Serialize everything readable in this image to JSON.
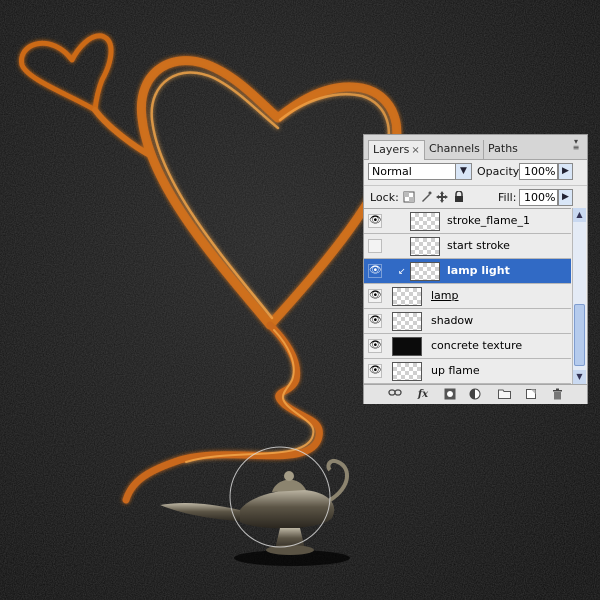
{
  "panel": {
    "tabs": [
      {
        "label": "Layers",
        "active": true
      },
      {
        "label": "Channels",
        "active": false
      },
      {
        "label": "Paths",
        "active": false
      }
    ],
    "close_glyph": "×",
    "menu_icon": "panel-menu-icon"
  },
  "blend_mode": {
    "value": "Normal"
  },
  "opacity": {
    "label": "Opacity:",
    "value": "100%"
  },
  "lock": {
    "label": "Lock:",
    "icons": [
      "lock-transparent-icon",
      "lock-image-icon",
      "lock-position-icon",
      "lock-all-icon"
    ]
  },
  "fill": {
    "label": "Fill:",
    "value": "100%"
  },
  "layers": [
    {
      "name": "stroke_flame_1",
      "visible": true,
      "indent": true,
      "thumb": "transparent",
      "selected": false,
      "underline": false
    },
    {
      "name": "start stroke",
      "visible": false,
      "indent": true,
      "thumb": "transparent",
      "selected": false,
      "underline": false
    },
    {
      "name": "lamp light",
      "visible": true,
      "indent": true,
      "thumb": "transparent",
      "selected": true,
      "underline": false
    },
    {
      "name": "lamp",
      "visible": true,
      "indent": false,
      "thumb": "transparent",
      "selected": false,
      "underline": true
    },
    {
      "name": "shadow",
      "visible": true,
      "indent": false,
      "thumb": "transparent",
      "selected": false,
      "underline": false
    },
    {
      "name": "concrete texture",
      "visible": true,
      "indent": false,
      "thumb": "black",
      "selected": false,
      "underline": false
    },
    {
      "name": "up flame",
      "visible": true,
      "indent": false,
      "thumb": "transparent",
      "selected": false,
      "underline": false
    }
  ],
  "bottom_icons": [
    "link-layers-icon",
    "fx-icon",
    "layer-mask-icon",
    "adjustment-layer-icon",
    "new-group-icon",
    "new-layer-icon",
    "trash-icon"
  ],
  "fx_label": "fx",
  "colors": {
    "flame": "#e07a1c",
    "selected_row": "#316ac5",
    "canvas_bg": "#0d0d0d"
  }
}
